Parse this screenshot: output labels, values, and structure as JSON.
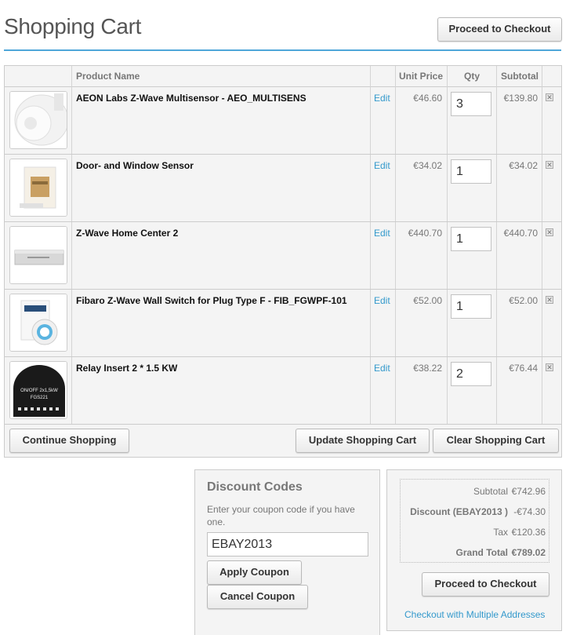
{
  "header": {
    "title": "Shopping Cart",
    "checkout_label": "Proceed to Checkout"
  },
  "cart": {
    "columns": {
      "product_name": "Product Name",
      "unit_price": "Unit Price",
      "qty": "Qty",
      "subtotal": "Subtotal"
    },
    "items": [
      {
        "name": "AEON Labs Z-Wave Multisensor - AEO_MULTISENS",
        "edit": "Edit",
        "unit_price": "€46.60",
        "qty": "3",
        "subtotal": "€139.80",
        "image": "multisensor-image"
      },
      {
        "name": "Door- and Window Sensor",
        "edit": "Edit",
        "unit_price": "€34.02",
        "qty": "1",
        "subtotal": "€34.02",
        "image": "door-sensor-image"
      },
      {
        "name": "Z-Wave Home Center 2",
        "edit": "Edit",
        "unit_price": "€440.70",
        "qty": "1",
        "subtotal": "€440.70",
        "image": "home-center-image"
      },
      {
        "name": "Fibaro Z-Wave Wall Switch for Plug Type F - FIB_FGWPF-101",
        "edit": "Edit",
        "unit_price": "€52.00",
        "qty": "1",
        "subtotal": "€52.00",
        "image": "wall-plug-image"
      },
      {
        "name": "Relay Insert 2 * 1.5 KW",
        "edit": "Edit",
        "unit_price": "€38.22",
        "qty": "2",
        "subtotal": "€76.44",
        "image": "relay-insert-image"
      }
    ],
    "continue_label": "Continue Shopping",
    "update_label": "Update Shopping Cart",
    "clear_label": "Clear Shopping Cart"
  },
  "discount": {
    "title": "Discount Codes",
    "description": "Enter your coupon code if you have one.",
    "code_value": "EBAY2013",
    "apply_label": "Apply Coupon",
    "cancel_label": "Cancel Coupon"
  },
  "totals": {
    "subtotal_label": "Subtotal",
    "subtotal_value": "€742.96",
    "discount_label": "Discount (EBAY2013 )",
    "discount_value": "-€74.30",
    "tax_label": "Tax",
    "tax_value": "€120.36",
    "grand_label": "Grand Total",
    "grand_value": "€789.02",
    "checkout_label": "Proceed to Checkout",
    "multi_label": "Checkout with Multiple Addresses"
  },
  "relay_image_text": {
    "line1": "ON/OFF 2x1,5kW",
    "line2": "FGS221"
  },
  "colors": {
    "accent": "#4fa6d9",
    "link": "#3399cc"
  }
}
